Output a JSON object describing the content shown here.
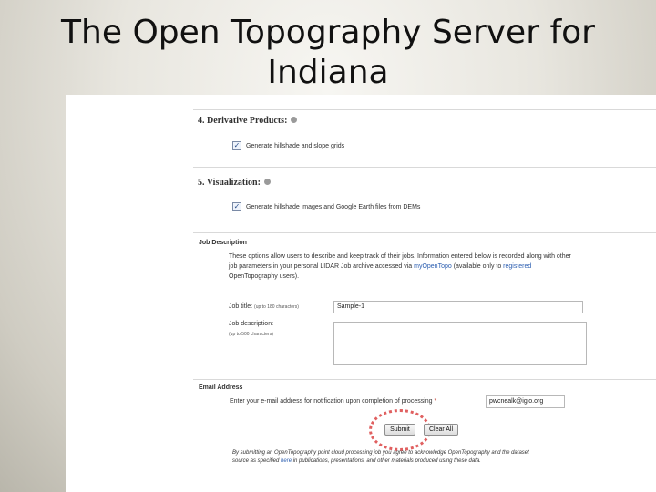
{
  "slide": {
    "title_line1": "The Open Topography Server for",
    "title_line2": "Indiana"
  },
  "form": {
    "section4": {
      "heading": "4. Derivative Products:",
      "option_label": "Generate hillshade and slope grids",
      "checked": true
    },
    "section5": {
      "heading": "5. Visualization:",
      "option_label": "Generate hillshade images and Google Earth files from DEMs",
      "checked": true
    },
    "job": {
      "heading": "Job Description",
      "intro_line1": "These options allow users to describe and keep track of their jobs. Information entered below is recorded along with other",
      "intro_line2_a": "job parameters in your personal LIDAR Job archive accessed via ",
      "intro_link1": "myOpenTopo",
      "intro_line2_b": " (available only to ",
      "intro_link2": "registered",
      "intro_line3": "OpenTopography users).",
      "title_label": "Job title:",
      "title_hint": "(up to 180 characters)",
      "title_value": "Sample-1",
      "desc_label": "Job description:",
      "desc_hint": "(up to 500 characters)",
      "desc_value": ""
    },
    "email": {
      "heading": "Email Address",
      "prompt": "Enter your e-mail address for notification upon completion of processing",
      "required_mark": "*",
      "value": "pwcnealk@iglo.org"
    },
    "buttons": {
      "submit": "Submit",
      "clear": "Clear All"
    },
    "disclaimer": {
      "line1": "By submitting an OpenTopography point cloud processing job you agree to acknowledge OpenTopography and the dataset",
      "line2_a": "source as specified ",
      "line2_link": "here",
      "line2_b": " in publications, presentations, and other materials produced using these data."
    },
    "accent_color": "#2a5db0",
    "highlight_color": "#e06060"
  }
}
